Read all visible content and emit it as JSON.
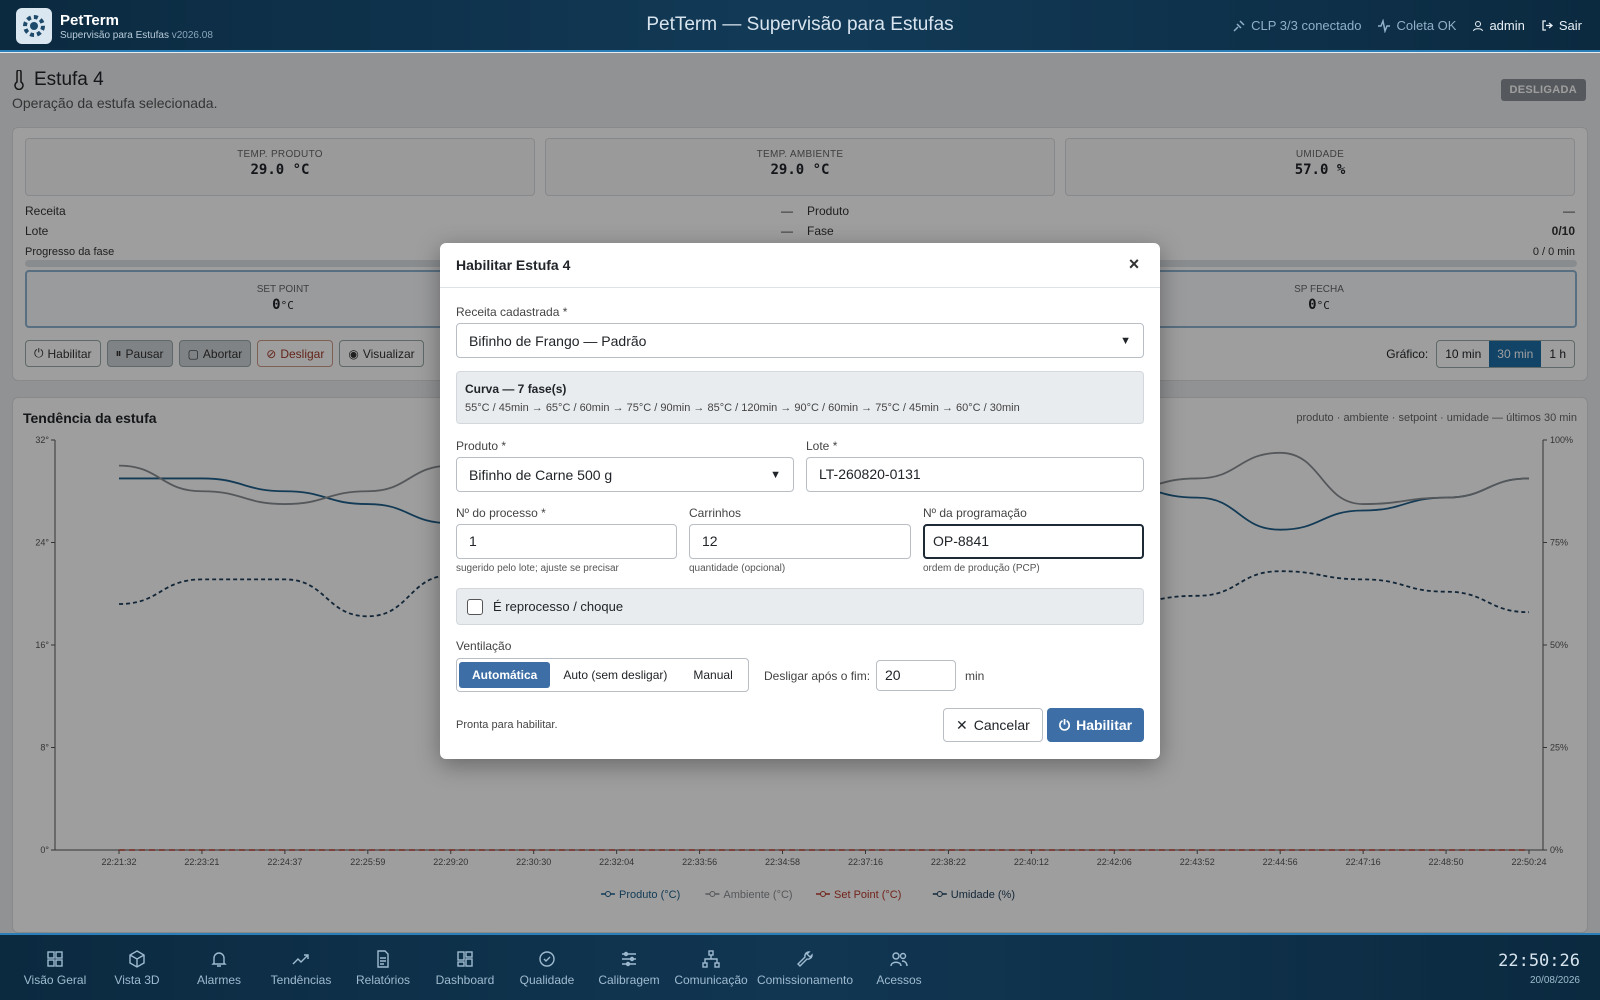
{
  "app": {
    "name": "PetTerm",
    "subtitle": "Supervisão para Estufas",
    "version": "v2026.08",
    "title": "PetTerm — Supervisão para Estufas"
  },
  "status": {
    "clp": "CLP 3/3 conectado",
    "coleta": "Coleta OK",
    "user": "admin",
    "logout": "Sair"
  },
  "page": {
    "title": "Estufa 4",
    "subtitle": "Operação da estufa selecionada.",
    "state": "DESLIGADA"
  },
  "metrics": [
    {
      "label": "TEMP. PRODUTO",
      "value": "29.0 °C"
    },
    {
      "label": "TEMP. AMBIENTE",
      "value": "29.0 °C"
    },
    {
      "label": "UMIDADE",
      "value": "57.0 %"
    }
  ],
  "info": {
    "receita_label": "Receita",
    "receita_value": "—",
    "produto_label": "Produto",
    "produto_value": "—",
    "lote_label": "Lote",
    "lote_value": "—",
    "fase_label": "Fase",
    "fase_value": "0/10",
    "progress_label": "Progresso da fase",
    "progress_value": "0 / 0 min",
    "progress_fraction": 0
  },
  "setpoints": {
    "sp_label": "SET POINT",
    "sp_value": "0",
    "sp_fecha_label": "SP FECHA",
    "sp_fecha_value": "0",
    "unit": "°C"
  },
  "actions": [
    "Habilitar",
    "Pausar",
    "Abortar",
    "Desligar",
    "Visualizar"
  ],
  "range": {
    "label": "Gráfico:",
    "options": [
      "10 min",
      "30 min",
      "1 h"
    ],
    "selected": "30 min"
  },
  "chart_data": {
    "type": "line",
    "title": "Tendência da estufa",
    "note": "produto · ambiente · setpoint · umidade — últimos 30 min",
    "x": [
      "22:21:32",
      "22:23:21",
      "22:24:37",
      "22:25:59",
      "22:29:20",
      "22:30:30",
      "22:32:04",
      "22:33:56",
      "22:34:58",
      "22:37:16",
      "22:38:22",
      "22:40:12",
      "22:42:06",
      "22:43:52",
      "22:44:56",
      "22:47:16",
      "22:48:50",
      "22:50:24"
    ],
    "y_left_ticks": [
      "0°",
      "8°",
      "16°",
      "24°",
      "32°"
    ],
    "y_left_range": [
      0,
      32
    ],
    "y_right_ticks": [
      "0%",
      "25%",
      "50%",
      "75%",
      "100%"
    ],
    "y_right_range": [
      0,
      100
    ],
    "series": [
      {
        "name": "Produto (°C)",
        "color": "#1f5f8b",
        "axis": "left",
        "values": [
          29,
          29,
          28,
          27,
          25.5,
          28.5,
          27,
          26.5,
          26,
          27,
          28,
          28.5,
          28.5,
          27.5,
          25,
          26.5,
          27.5,
          29
        ]
      },
      {
        "name": "Ambiente (°C)",
        "color": "#8a8e93",
        "axis": "left",
        "values": [
          30,
          28,
          27,
          28,
          30,
          29,
          28,
          27,
          27,
          27.5,
          28,
          28,
          28,
          29,
          31,
          27,
          27.5,
          29
        ]
      },
      {
        "name": "Set Point (°C)",
        "color": "#b83a2c",
        "axis": "left",
        "values": [
          0,
          0,
          0,
          0,
          0,
          0,
          0,
          0,
          0,
          0,
          0,
          0,
          0,
          0,
          0,
          0,
          0,
          0
        ]
      },
      {
        "name": "Umidade (%)",
        "color": "#1e3e5a",
        "axis": "right",
        "values": [
          60,
          66,
          66,
          57,
          67,
          60,
          58,
          57,
          57,
          57,
          57,
          58,
          60,
          62,
          68,
          66,
          63,
          58
        ]
      }
    ]
  },
  "modal": {
    "title": "Habilitar Estufa 4",
    "receita_label": "Receita cadastrada *",
    "receita_value": "Bifinho de Frango — Padrão",
    "curve_title": "Curva — 7 fase(s)",
    "curve_steps": "55°C / 45min → 65°C / 60min → 75°C / 90min → 85°C / 120min → 90°C / 60min → 75°C / 45min → 60°C / 30min",
    "produto_label": "Produto *",
    "produto_value": "Bifinho de Carne 500 g",
    "lote_label": "Lote *",
    "lote_value": "LT-260820-0131",
    "processo_label": "Nº do processo *",
    "processo_value": "1",
    "processo_hint": "sugerido pelo lote; ajuste se precisar",
    "carrinhos_label": "Carrinhos",
    "carrinhos_value": "12",
    "carrinhos_hint": "quantidade (opcional)",
    "programacao_label": "Nº da programação",
    "programacao_value": "OP-8841",
    "programacao_hint": "ordem de produção (PCP)",
    "reprocesso_label": "É reprocesso / choque",
    "ventilacao_label": "Ventilação",
    "ventilacao_options": [
      "Automática",
      "Auto (sem desligar)",
      "Manual"
    ],
    "ventilacao_selected": "Automática",
    "desligar_label": "Desligar após o fim:",
    "desligar_value": "20",
    "desligar_unit": "min",
    "status_text": "Pronta para habilitar.",
    "cancel_label": "Cancelar",
    "confirm_label": "Habilitar"
  },
  "nav": [
    "Visão Geral",
    "Vista 3D",
    "Alarmes",
    "Tendências",
    "Relatórios",
    "Dashboard",
    "Qualidade",
    "Calibragem",
    "Comunicação",
    "Comissionamento",
    "Acessos"
  ],
  "clock": {
    "time": "22:50:26",
    "date": "20/08/2026"
  }
}
